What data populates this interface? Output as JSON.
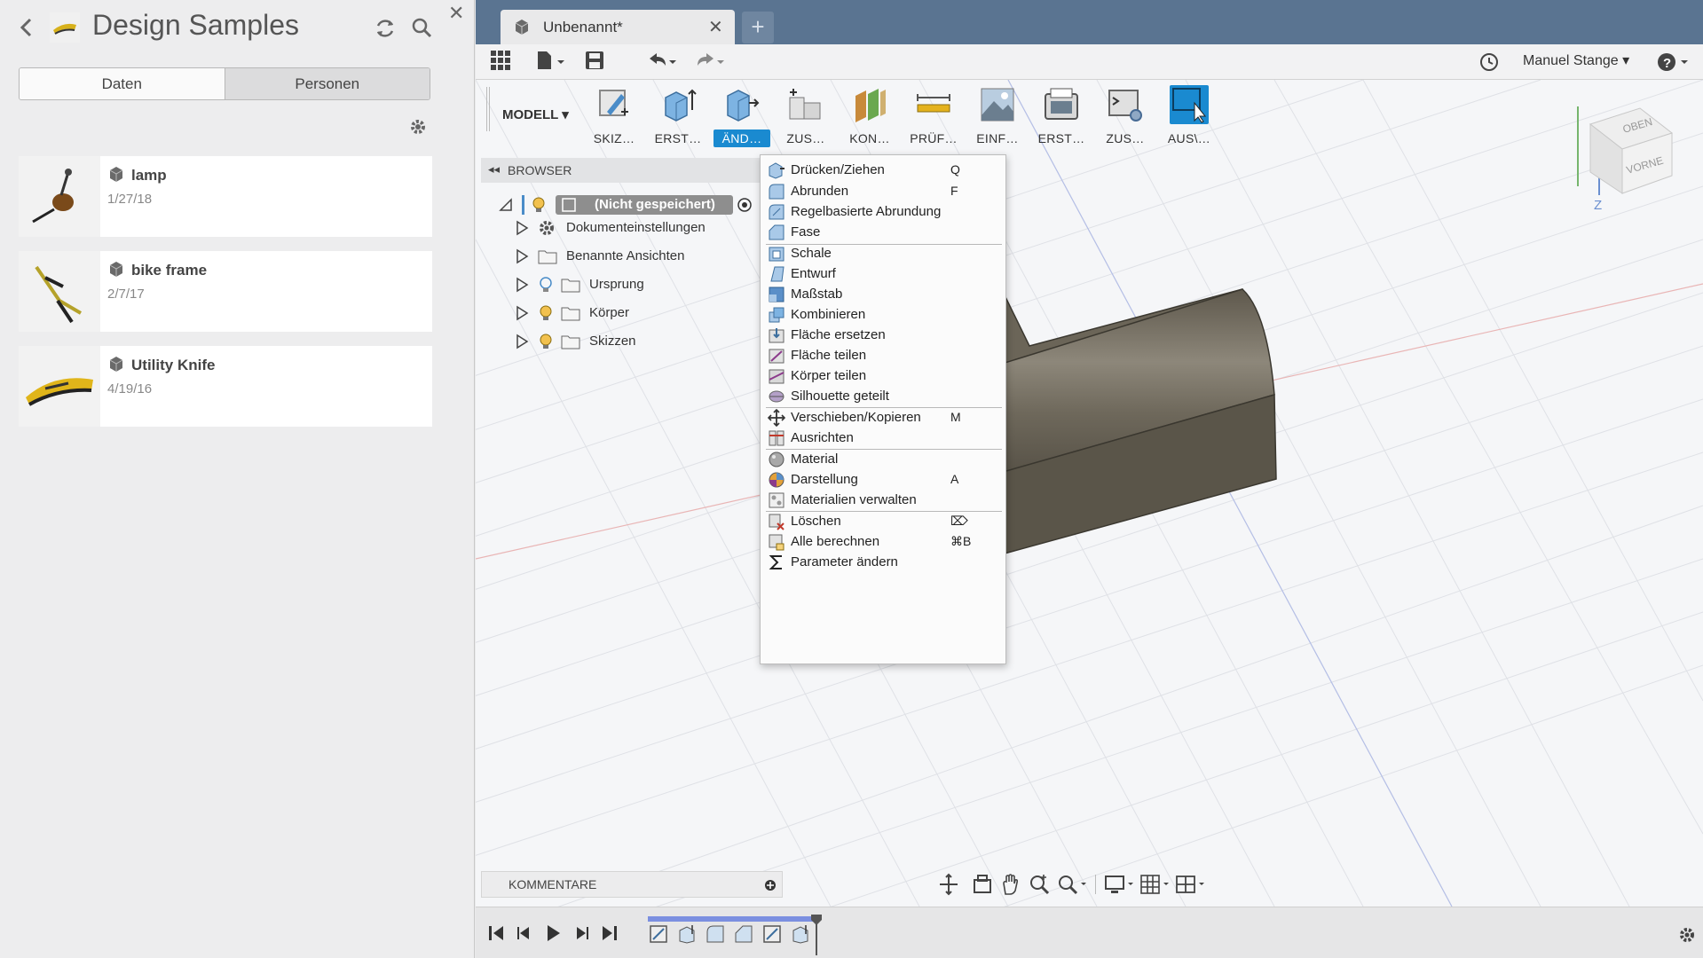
{
  "left_panel": {
    "title": "Design Samples",
    "tabs": [
      "Daten",
      "Personen"
    ],
    "items": [
      {
        "name": "lamp",
        "date": "1/27/18"
      },
      {
        "name": "bike frame",
        "date": "2/7/17"
      },
      {
        "name": "Utility Knife",
        "date": "4/19/16"
      }
    ]
  },
  "doc_tab": {
    "label": "Unbenannt*",
    "new_tab": "+"
  },
  "appbar": {
    "user": "Manuel Stange"
  },
  "toolbar": {
    "mode": "MODELL",
    "groups": [
      {
        "label": "SKIZ…",
        "icon": "sketch-icon"
      },
      {
        "label": "ERST…",
        "icon": "create-icon"
      },
      {
        "label": "ÄND…",
        "icon": "modify-icon",
        "active": true
      },
      {
        "label": "ZUS…",
        "icon": "assemble-icon"
      },
      {
        "label": "KON…",
        "icon": "construct-icon"
      },
      {
        "label": "PRÜF…",
        "icon": "inspect-icon"
      },
      {
        "label": "EINF…",
        "icon": "insert-icon"
      },
      {
        "label": "ERST…",
        "icon": "make-icon"
      },
      {
        "label": "ZUS…",
        "icon": "addins-icon"
      },
      {
        "label": "AUS\\…",
        "icon": "select-icon"
      }
    ]
  },
  "browser": {
    "title": "BROWSER",
    "root": "(Nicht gespeichert)",
    "items": [
      {
        "label": "Dokumenteinstellungen"
      },
      {
        "label": "Benannte Ansichten"
      },
      {
        "label": "Ursprung"
      },
      {
        "label": "Körper"
      },
      {
        "label": "Skizzen"
      }
    ]
  },
  "menu": {
    "items": [
      {
        "label": "Drücken/Ziehen",
        "key": "Q"
      },
      {
        "label": "Abrunden",
        "key": "F"
      },
      {
        "label": "Regelbasierte Abrundung",
        "key": ""
      },
      {
        "label": "Fase",
        "key": ""
      },
      {
        "label": "Schale",
        "key": ""
      },
      {
        "label": "Entwurf",
        "key": ""
      },
      {
        "label": "Maßstab",
        "key": ""
      },
      {
        "label": "Kombinieren",
        "key": ""
      },
      {
        "label": "Fläche ersetzen",
        "key": ""
      },
      {
        "label": "Fläche teilen",
        "key": ""
      },
      {
        "label": "Körper teilen",
        "key": ""
      },
      {
        "label": "Silhouette geteilt",
        "key": ""
      },
      {
        "label": "Verschieben/Kopieren",
        "key": "M"
      },
      {
        "label": "Ausrichten",
        "key": ""
      },
      {
        "label": "Material",
        "key": ""
      },
      {
        "label": "Darstellung",
        "key": "A"
      },
      {
        "label": "Materialien verwalten",
        "key": ""
      },
      {
        "label": "Löschen",
        "key": "⌦"
      },
      {
        "label": "Alle berechnen",
        "key": "⌘B"
      },
      {
        "label": "Parameter ändern",
        "key": ""
      }
    ]
  },
  "viewcube": {
    "top": "OBEN",
    "front": "VORNE",
    "axis_z": "Z"
  },
  "comments": {
    "label": "KOMMENTARE"
  },
  "colors": {
    "accent": "#1a8ad0",
    "tabstrip": "#5a7491",
    "model": "#6b6558"
  }
}
